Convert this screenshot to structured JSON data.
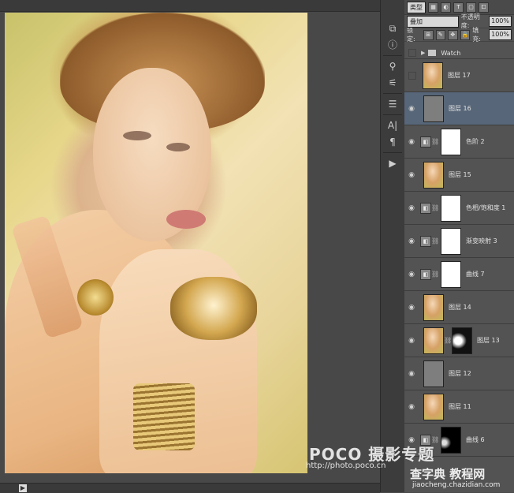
{
  "panel": {
    "filter_kind": "类型",
    "blend_mode": "叠加",
    "opacity_label": "不透明度:",
    "opacity_value": "100%",
    "lock_label": "锁定:",
    "fill_label": "填充:",
    "fill_value": "100%"
  },
  "tools": [
    "⧉",
    "ⓘ",
    "⚲",
    "⚟",
    "☰",
    "A|",
    "¶",
    "▶"
  ],
  "layers": [
    {
      "name": "Watch",
      "type": "group",
      "visible": false
    },
    {
      "name": "图层 17",
      "type": "photo",
      "visible": false
    },
    {
      "name": "图层 16",
      "type": "gray",
      "visible": true,
      "selected": true
    },
    {
      "name": "色阶 2",
      "type": "adjustment",
      "adj_icon": "levels-icon",
      "visible": true
    },
    {
      "name": "图层 15",
      "type": "photo",
      "visible": true
    },
    {
      "name": "色相/饱和度 1",
      "type": "adjustment",
      "adj_icon": "hue-saturation-icon",
      "visible": true
    },
    {
      "name": "渐变映射 3",
      "type": "adjustment",
      "adj_icon": "gradient-map-icon",
      "visible": true
    },
    {
      "name": "曲线 7",
      "type": "adjustment",
      "adj_icon": "curves-icon",
      "visible": true
    },
    {
      "name": "图层 14",
      "type": "photo",
      "visible": true
    },
    {
      "name": "图层 13",
      "type": "photo-mask",
      "visible": true
    },
    {
      "name": "图层 12",
      "type": "gray",
      "visible": true
    },
    {
      "name": "图层 11",
      "type": "photo",
      "visible": true
    },
    {
      "name": "曲线 6",
      "type": "adjustment-mask",
      "adj_icon": "curves-icon",
      "visible": true
    }
  ],
  "watermark": {
    "brand": "POCO 摄影专题",
    "url": "http://photo.poco.cn",
    "site": "查字典 教程网",
    "site_url": "jiaocheng.chazidian.com"
  }
}
